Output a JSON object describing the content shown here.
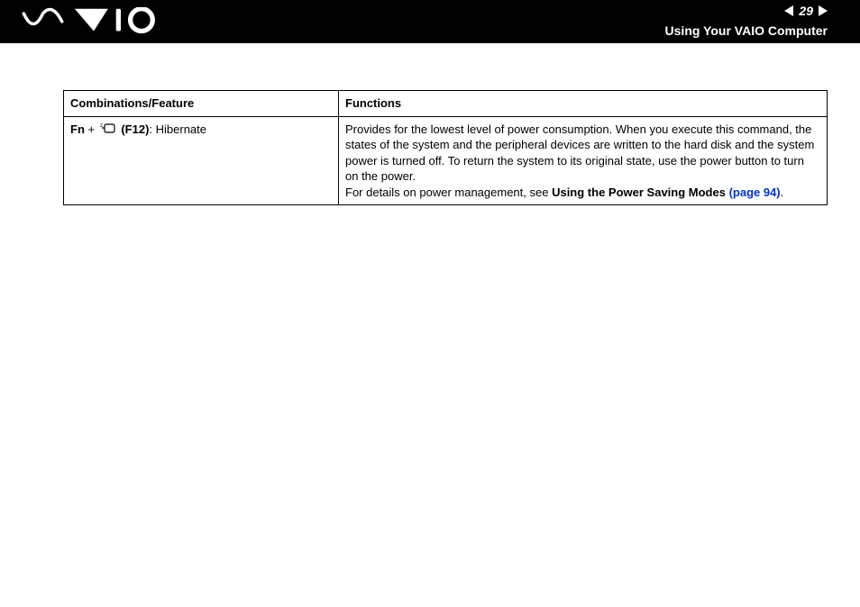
{
  "header": {
    "page_number": "29",
    "section_title": "Using Your VAIO Computer",
    "logo_alt": "VAIO"
  },
  "table": {
    "headers": {
      "combo": "Combinations/Feature",
      "functions": "Functions"
    },
    "row": {
      "fn": "Fn",
      "plus": " + ",
      "key": "(F12)",
      "label": ": Hibernate",
      "desc_main": "Provides for the lowest level of power consumption. When you execute this command, the states of the system and the peripheral devices are written to the hard disk and the system power is turned off. To return the system to its original state, use the power button to turn on the power.",
      "desc_detail_prefix": "For details on power management, see ",
      "desc_detail_bold": "Using the Power Saving Modes ",
      "desc_detail_link": "(page 94)",
      "desc_detail_suffix": "."
    }
  }
}
